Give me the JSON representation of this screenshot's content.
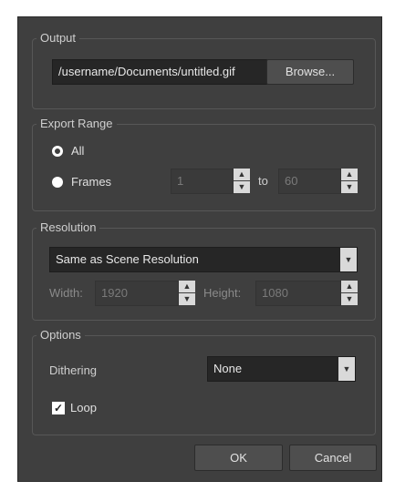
{
  "output": {
    "legend": "Output",
    "path_value": "/username/Documents/untitled.gif",
    "browse_label": "Browse..."
  },
  "export_range": {
    "legend": "Export Range",
    "all_label": "All",
    "frames_label": "Frames",
    "selected": "All",
    "from_value": "1",
    "to_label": "to",
    "to_value": "60"
  },
  "resolution": {
    "legend": "Resolution",
    "selected_option": "Same as Scene Resolution",
    "width_label": "Width:",
    "width_value": "1920",
    "height_label": "Height:",
    "height_value": "1080"
  },
  "options": {
    "legend": "Options",
    "dithering_label": "Dithering",
    "dithering_value": "None",
    "loop_label": "Loop",
    "loop_checked": true
  },
  "buttons": {
    "ok_label": "OK",
    "cancel_label": "Cancel"
  },
  "icons": {
    "spin_up": "triangle-up-icon",
    "spin_down": "triangle-down-icon",
    "dropdown": "triangle-down-icon",
    "check": "check-icon"
  },
  "colors": {
    "dialog_bg": "#3f3f3f",
    "field_bg": "#262626",
    "button_bg": "#4e4e4e"
  }
}
